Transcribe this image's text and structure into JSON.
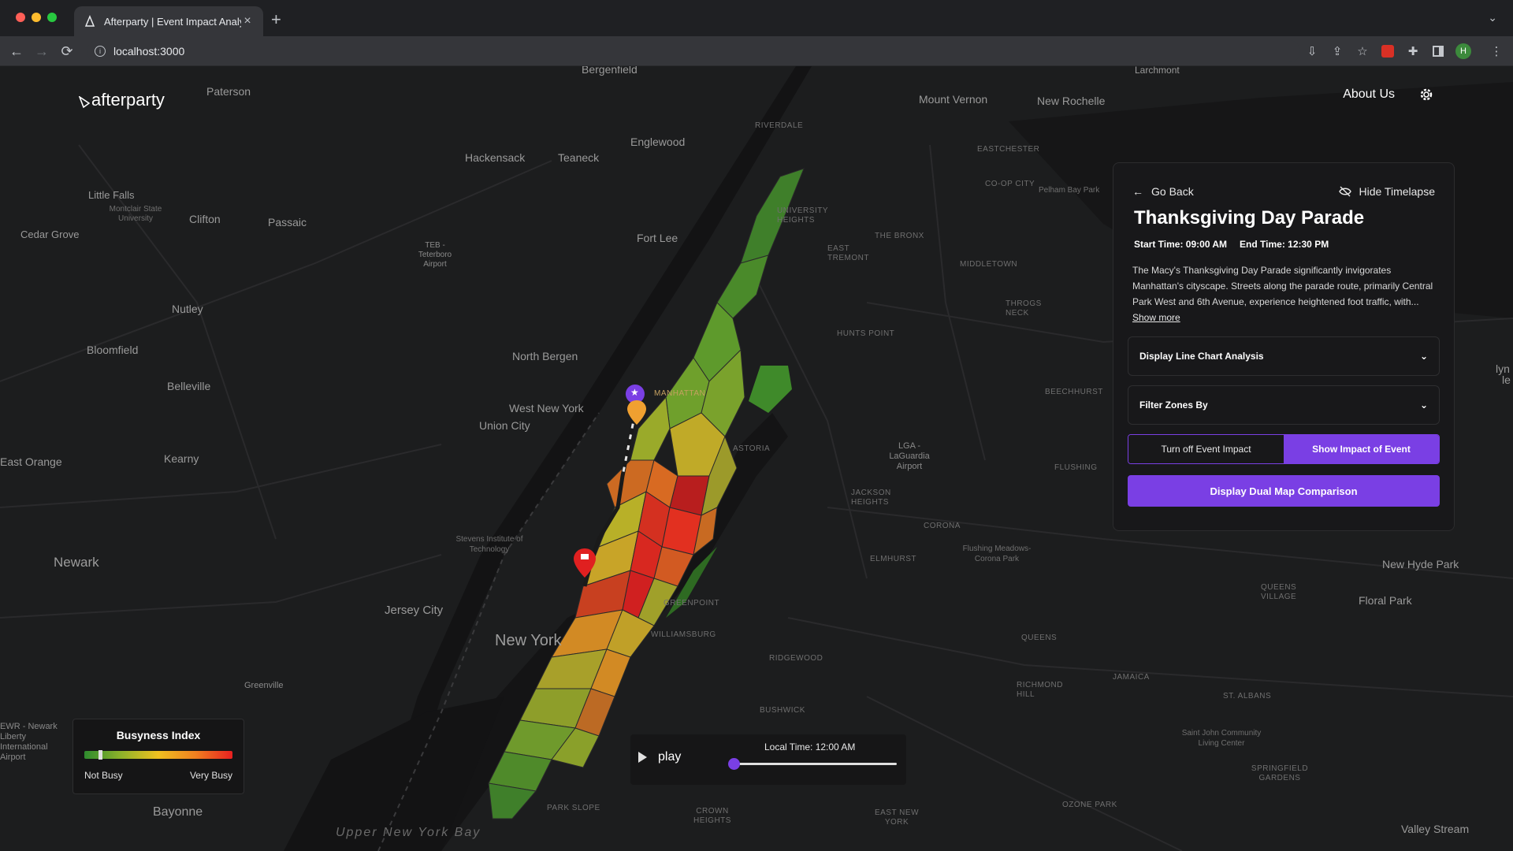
{
  "browser": {
    "tab_title": "Afterparty | Event Impact Analy",
    "url": "localhost:3000",
    "profile_initial": "H"
  },
  "app": {
    "logo": "afterparty",
    "about_label": "About Us"
  },
  "map_labels": {
    "bergenfield": "Bergenfield",
    "paterson": "Paterson",
    "larchmont": "Larchmont",
    "mount_vernon": "Mount Vernon",
    "new_rochelle": "New Rochelle",
    "riverdale": "RIVERDALE",
    "eastchester": "EASTCHESTER",
    "coop_city": "CO-OP CITY",
    "pelham_bay_park": "Pelham Bay Park",
    "hackensack": "Hackensack",
    "teaneck": "Teaneck",
    "englewood": "Englewood",
    "little_falls": "Little Falls",
    "montclair": "Montclair State University",
    "clifton": "Clifton",
    "passaic": "Passaic",
    "cedar_grove": "Cedar Grove",
    "teb": "TEB - Teterboro Airport",
    "fort_lee": "Fort Lee",
    "university_heights": "UNIVERSITY HEIGHTS",
    "the_bronx": "THE BRONX",
    "east_tremont": "EAST TREMONT",
    "middletown": "MIDDLETOWN",
    "throgs_neck": "THROGS NECK",
    "nutley": "Nutley",
    "bloomfield": "Bloomfield",
    "belleville": "Belleville",
    "north_bergen": "North Bergen",
    "hunts_point": "HUNTS POINT",
    "west_new_york": "West New York",
    "union_city": "Union City",
    "manhattan": "MANHATTAN",
    "beechhurst": "BEECHHURST",
    "east_orange": "East Orange",
    "kearny": "Kearny",
    "astoria": "ASTORIA",
    "lga": "LGA - LaGuardia Airport",
    "flushing": "FLUSHING",
    "jackson_heights": "JACKSON HEIGHTS",
    "corona": "CORONA",
    "elmhurst": "ELMHURST",
    "flushing_meadows": "Flushing Meadows-Corona Park",
    "newark": "Newark",
    "stevens": "Stevens Institute of Technology",
    "jersey_city": "Jersey City",
    "new_york": "New York",
    "greenpoint": "GREENPOINT",
    "williamsburg": "WILLIAMSBURG",
    "ridgewood": "RIDGEWOOD",
    "queens": "QUEENS",
    "queens_village": "QUEENS VILLAGE",
    "new_hyde_park": "New Hyde Park",
    "floral_park": "Floral Park",
    "richmond_hill": "RICHMOND HILL",
    "jamaica": "JAMAICA",
    "st_albans": "ST. ALBANS",
    "greenville": "Greenville",
    "bushwick": "BUSHWICK",
    "saint_john": "Saint John Community Living Center",
    "springfield_gardens": "SPRINGFIELD GARDENS",
    "ewr": "EWR - Newark Liberty International Airport",
    "bayonne": "Bayonne",
    "park_slope": "PARK SLOPE",
    "crown_heights": "CROWN HEIGHTS",
    "east_new_york": "EAST NEW YORK",
    "ozone_park": "OZONE PARK",
    "valley_stream": "Valley Stream",
    "upper_new_york_bay": "Upper New York Bay",
    "lyn": "lyn",
    "le": "le"
  },
  "panel": {
    "go_back": "Go Back",
    "hide_timelapse": "Hide Timelapse",
    "title": "Thanksgiving Day Parade",
    "start_time": "Start Time: 09:00 AM",
    "end_time": "End Time: 12:30 PM",
    "description": "The Macy's Thanksgiving Day Parade significantly invigorates Manhattan's cityscape. Streets along the parade route, primarily Central Park West and 6th Avenue, experience heightened foot traffic, with...",
    "show_more": "Show more",
    "line_chart_label": "Display Line Chart Analysis",
    "filter_label": "Filter Zones By",
    "turn_off_label": "Turn off Event Impact",
    "show_impact_label": "Show Impact of Event",
    "dual_map_label": "Display Dual Map Comparison"
  },
  "legend": {
    "title": "Busyness Index",
    "low_label": "Not Busy",
    "high_label": "Very Busy"
  },
  "player": {
    "play_label": "play",
    "local_time": "Local Time: 12:00 AM",
    "progress": 0
  },
  "colors": {
    "accent": "#7a3fe4",
    "busy_high": "#e82020",
    "busy_low": "#2e8b2e"
  }
}
